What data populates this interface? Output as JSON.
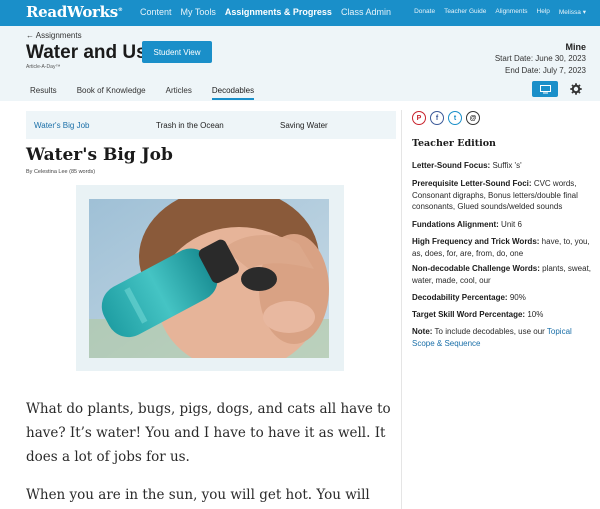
{
  "topnav": {
    "logo": "ReadWorks",
    "logo_mark": "®",
    "main": [
      "Content",
      "My Tools",
      "Assignments & Progress",
      "Class Admin"
    ],
    "active_index": 2,
    "right": [
      "Donate",
      "Teacher Guide",
      "Alignments",
      "Help",
      "Melissa"
    ]
  },
  "header": {
    "back": "← Assignments",
    "title": "Water and Us",
    "tag": "Article-A-Day™",
    "student_view": "Student View",
    "owner": "Mine",
    "start_date": "Start Date: June 30, 2023",
    "end_date": "End Date: July 7, 2023"
  },
  "tabs": [
    "Results",
    "Book of Knowledge",
    "Articles",
    "Decodables"
  ],
  "active_tab": 3,
  "stories": [
    "Water's Big Job",
    "Trash in the Ocean",
    "Saving Water"
  ],
  "story": {
    "title": "Water's Big Job",
    "byline": "By Celestina Lee (85 words)",
    "p1": "What do plants, bugs, pigs, dogs, and cats all have to have? It’s water! You and I have to have it as well. It does a lot of jobs for us.",
    "p2": "When you are in the sun, you will get hot. You will"
  },
  "sidebar": {
    "share": [
      "P",
      "f",
      "t",
      "@"
    ],
    "title": "Teacher Edition",
    "focus_label": "Letter-Sound Focus:",
    "focus_value": "Suffix 's'",
    "prereq_label": "Prerequisite Letter-Sound Foci:",
    "prereq_value": "CVC words, Consonant digraphs, Bonus letters/double final consonants, Glued sounds/welded sounds",
    "fund_label": "Fundations Alignment:",
    "fund_value": "Unit 6",
    "hf_label": "High Frequency and Trick Words:",
    "hf_value": "have, to, you, as, does, for, are, from, do, one",
    "nd_label": "Non-decodable Challenge Words:",
    "nd_value": "plants, sweat, water, made, cool, our",
    "dp_label": "Decodability Percentage:",
    "dp_value": "90%",
    "ts_label": "Target Skill Word Percentage:",
    "ts_value": "10%",
    "note_label": "Note:",
    "note_text": "To include decodables, use our",
    "note_link": "Topical Scope & Sequence"
  }
}
